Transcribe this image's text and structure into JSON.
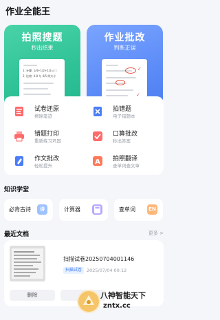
{
  "header": {
    "title": "作业全能王"
  },
  "hero": {
    "left": {
      "title": "拍照搜题",
      "subtitle": "秒出结果"
    },
    "right": {
      "title": "作业批改",
      "subtitle": "判断正误"
    }
  },
  "tools": [
    {
      "name": "试卷还原",
      "desc": "擦除笔迹",
      "color": "#ff6a6a",
      "icon": "doc-restore-icon"
    },
    {
      "name": "拍错题",
      "desc": "电子错题本",
      "color": "#4a7df7",
      "icon": "mistake-book-icon"
    },
    {
      "name": "错题打印",
      "desc": "重新练习巩固",
      "color": "#ff6a6a",
      "icon": "printer-icon"
    },
    {
      "name": "口算批改",
      "desc": "秒出答案",
      "color": "#ff6a6a",
      "icon": "calc-check-icon"
    },
    {
      "name": "作文批改",
      "desc": "轻松提升",
      "color": "#4a7df7",
      "icon": "essay-icon"
    },
    {
      "name": "拍照翻译",
      "desc": "查单词查文章",
      "color": "#ff7a5a",
      "icon": "translate-icon"
    }
  ],
  "knowledge": {
    "title": "知识学堂",
    "items": [
      {
        "label": "必背古诗",
        "badge": "诗",
        "color": "#9ec2ff"
      },
      {
        "label": "计算器",
        "badge": "",
        "color": "#b7a8ff"
      },
      {
        "label": "查单词",
        "badge": "EN",
        "color": "#ffb87a"
      }
    ]
  },
  "recent": {
    "title": "最近文档",
    "more": "更多 >",
    "doc": {
      "name": "扫描试卷20250704001146",
      "tag": "扫描试卷",
      "time": "2025/07/04 00:12",
      "delete_label": "删除",
      "other_label": ""
    }
  },
  "hero_paper": {
    "line1": "1. 计算: 1/4+1/2+1/2=(    )",
    "line2": "2. 比较: 0.8 与 4/5 的大小"
  },
  "watermark": {
    "text": "八神智能天下",
    "url": "zntx.cc"
  }
}
